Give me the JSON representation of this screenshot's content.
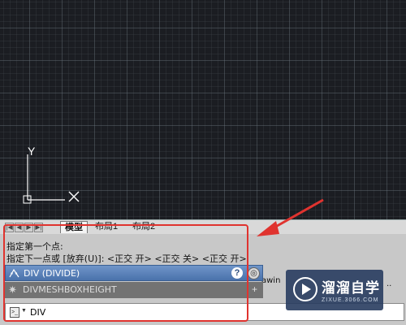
{
  "ucs": {
    "y_label": "Y"
  },
  "layout_tabs": [
    {
      "label": "模型",
      "active": true
    },
    {
      "label": "布局1",
      "active": false
    },
    {
      "label": "布局2",
      "active": false
    }
  ],
  "nav_buttons": [
    "|◀",
    "◀",
    "▶",
    "▶|"
  ],
  "command_history": [
    "指定第一个点:",
    "指定下一点或 [放弃(U)]:  <正交 开>  <正交 关>  <正交 开>"
  ],
  "suggestions": [
    {
      "label": "DIV (DIVIDE)",
      "icon": "divide-icon"
    },
    {
      "label": "DIVMESHBOXHEIGHT",
      "icon": "gear-icon"
    }
  ],
  "command_line": {
    "value": "DIV",
    "prompt_icon": "command-prompt-icon"
  },
  "background_snippets": {
    "behind_popup": "awin",
    "right_edge": ".."
  },
  "watermark": {
    "title": "溜溜自学",
    "subtitle": "ZIXUE.3066.COM"
  },
  "colors": {
    "canvas": "#1b1d22",
    "highlight": "#e0332f",
    "suggest_selected": "#5a82bb",
    "suggest_other": "#737373",
    "watermark_bg": "#283c5f"
  }
}
